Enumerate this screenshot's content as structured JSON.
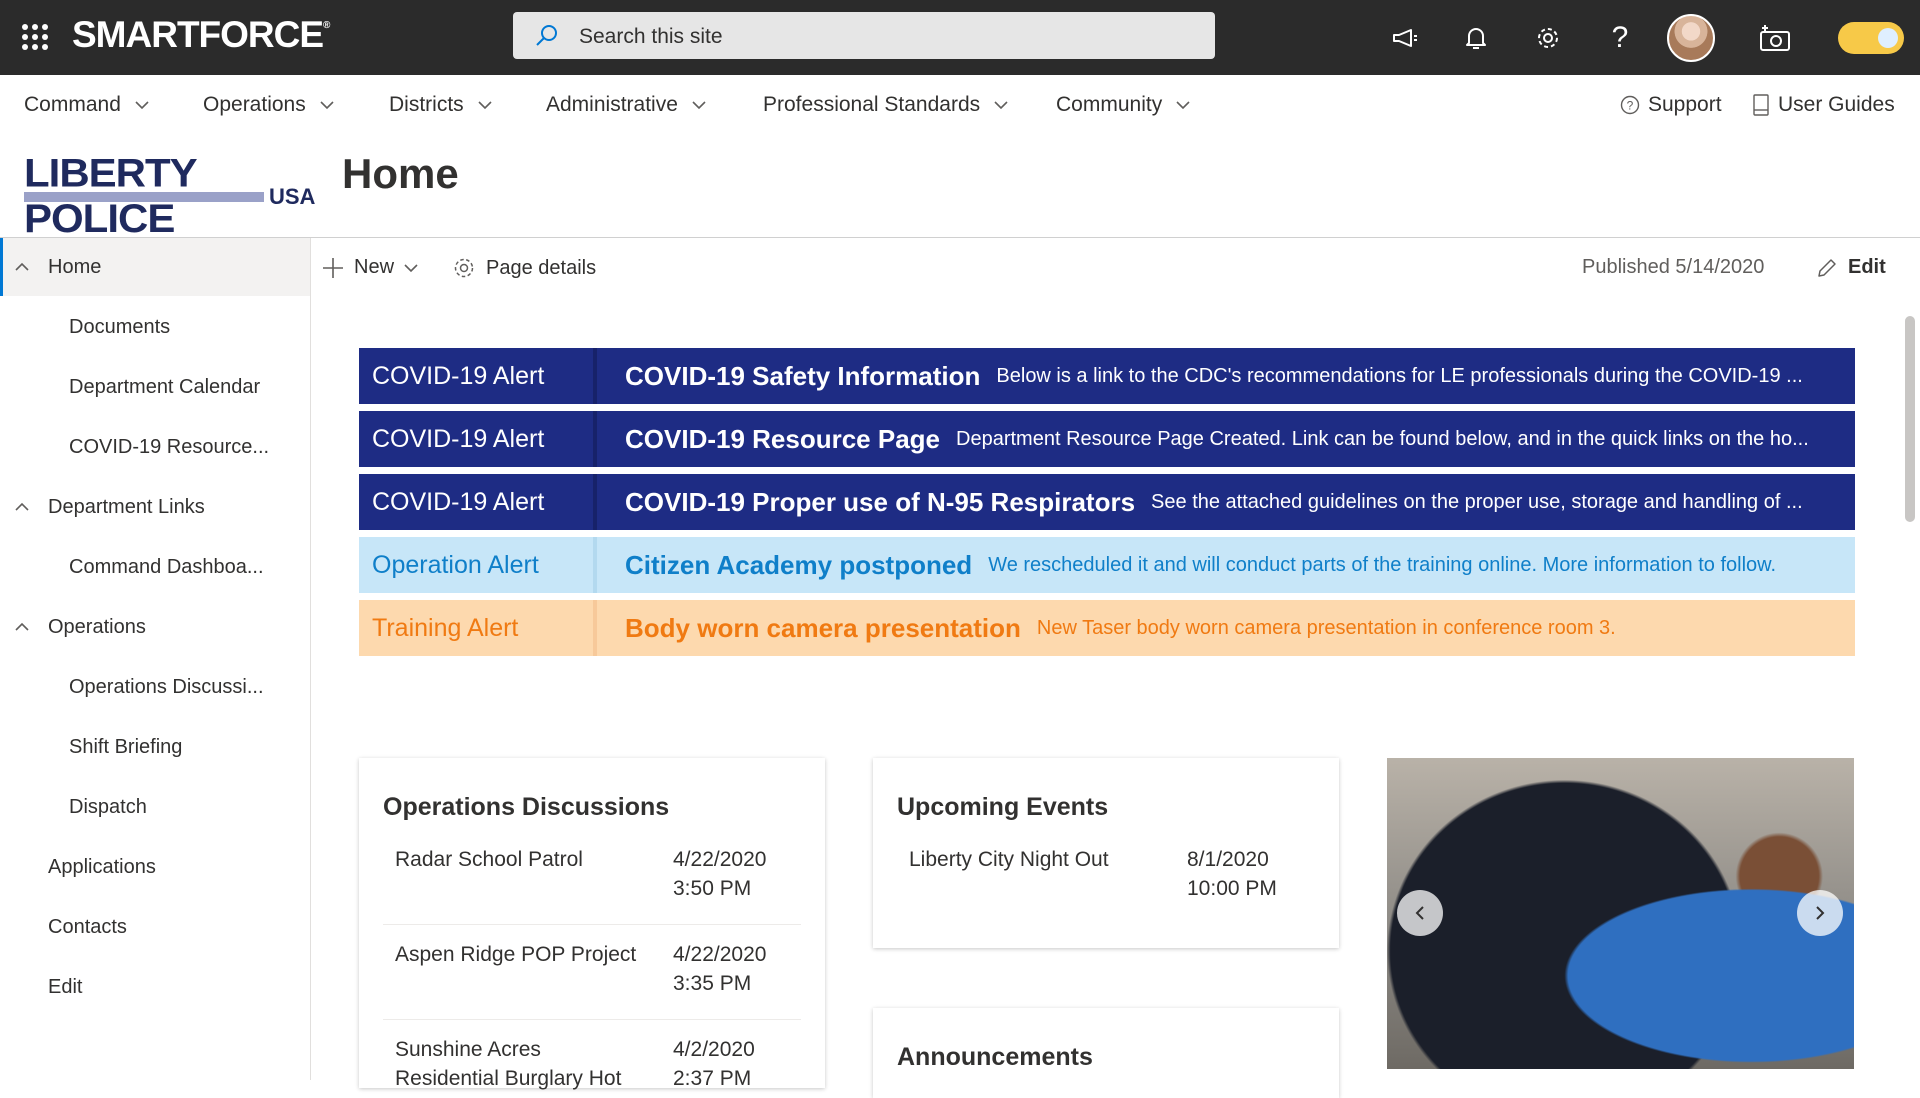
{
  "suitebar": {
    "brand": "SMARTFORCE",
    "brand_mark": "®",
    "search_placeholder": "Search this site",
    "icons": [
      "megaphone-icon",
      "bell-icon",
      "gear-icon",
      "help-icon",
      "avatar",
      "camera-icon",
      "theme-toggle"
    ]
  },
  "hubnav": {
    "items": [
      "Command",
      "Operations",
      "Districts",
      "Administrative",
      "Professional Standards",
      "Community"
    ],
    "support": "Support",
    "user_guides": "User Guides"
  },
  "site": {
    "logo_line1": "LIBERTY POLICE",
    "logo_line2": "USA",
    "title": "Home"
  },
  "leftnav": {
    "items": [
      {
        "label": "Home",
        "level": 0,
        "expanded": true,
        "active": true
      },
      {
        "label": "Documents",
        "level": 1
      },
      {
        "label": "Department Calendar",
        "level": 1
      },
      {
        "label": "COVID-19 Resource...",
        "level": 1
      },
      {
        "label": "Department Links",
        "level": 0,
        "expanded": true
      },
      {
        "label": "Command Dashboa...",
        "level": 1
      },
      {
        "label": "Operations",
        "level": 0,
        "expanded": true
      },
      {
        "label": "Operations Discussi...",
        "level": 1
      },
      {
        "label": "Shift Briefing",
        "level": 1
      },
      {
        "label": "Dispatch",
        "level": 1
      },
      {
        "label": "Applications",
        "level": 0
      },
      {
        "label": "Contacts",
        "level": 0
      },
      {
        "label": "Edit",
        "level": 0
      }
    ]
  },
  "commandbar": {
    "new_label": "New",
    "page_details_label": "Page details",
    "published": "Published 5/14/2020",
    "edit_label": "Edit"
  },
  "alerts": [
    {
      "tag": "COVID-19 Alert",
      "title": "COVID-19 Safety Information",
      "desc": "Below is a link to the CDC's recommendations for LE professionals during the COVID-19 ...",
      "bg": "#1e2c84",
      "sep": "#17226a",
      "fg": "#ffffff"
    },
    {
      "tag": "COVID-19 Alert",
      "title": "COVID-19 Resource Page",
      "desc": "Department Resource Page Created. Link can be found below, and in the quick links on the ho...",
      "bg": "#1e2c84",
      "sep": "#17226a",
      "fg": "#ffffff"
    },
    {
      "tag": "COVID-19 Alert",
      "title": "COVID-19 Proper use of N-95 Respirators",
      "desc": "See the attached guidelines on the proper use, storage and handling of ...",
      "bg": "#1e2c84",
      "sep": "#17226a",
      "fg": "#ffffff"
    },
    {
      "tag": "Operation Alert",
      "title": "Citizen Academy postponed",
      "desc": "We rescheduled it and will conduct parts of the training online. More information to follow.",
      "bg": "#c7e6f8",
      "sep": "#b3d9ef",
      "fg": "#0f7fc9"
    },
    {
      "tag": "Training Alert",
      "title": "Body worn camera presentation",
      "desc": "New Taser body worn camera presentation in conference room 3.",
      "bg": "#fdd9ae",
      "sep": "#f7c99a",
      "fg": "#f07a12"
    }
  ],
  "ops_discussions": {
    "title": "Operations Discussions",
    "rows": [
      {
        "subject": "Radar School Patrol",
        "date": "4/22/2020",
        "time": "3:50 PM"
      },
      {
        "subject": "Aspen Ridge POP Project",
        "date": "4/22/2020",
        "time": "3:35 PM"
      },
      {
        "subject": "Sunshine Acres",
        "subject2": "Residential Burglary Hot",
        "date": "4/2/2020",
        "time": "2:37 PM"
      }
    ]
  },
  "events": {
    "title": "Upcoming Events",
    "rows": [
      {
        "subject": "Liberty City Night Out",
        "date": "8/1/2020",
        "time": "10:00 PM"
      }
    ]
  },
  "announcements": {
    "title": "Announcements"
  },
  "carousel": {
    "prev_icon": "chevron-left-icon",
    "next_icon": "chevron-right-icon"
  }
}
